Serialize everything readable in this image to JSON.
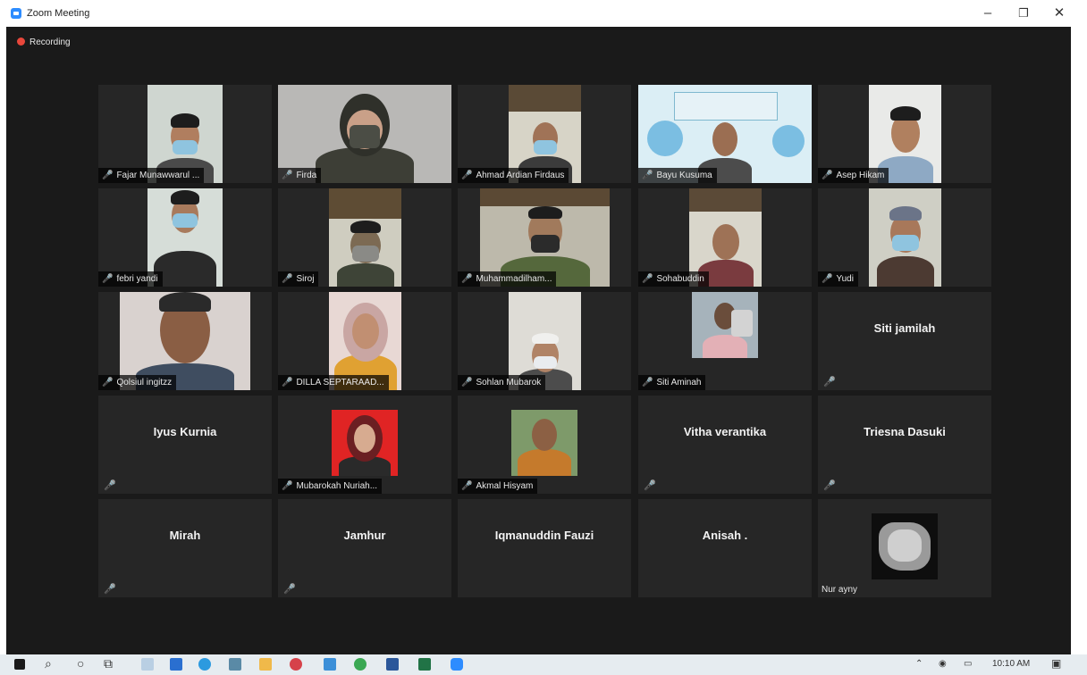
{
  "window": {
    "title": "Zoom Meeting",
    "minimize": "–",
    "restore": "❐",
    "close": "✕"
  },
  "recording": {
    "label": "Recording"
  },
  "participants": [
    {
      "name": "Fajar Munawwarul ..."
    },
    {
      "name": "Firda"
    },
    {
      "name": "Ahmad Ardian Firdaus"
    },
    {
      "name": "Bayu Kusuma"
    },
    {
      "name": "Asep Hikam"
    },
    {
      "name": "febri yandi"
    },
    {
      "name": "Siroj"
    },
    {
      "name": "Muhammadilham..."
    },
    {
      "name": "Sohabuddin"
    },
    {
      "name": "Yudi"
    },
    {
      "name": "Qolsiul ingitzz"
    },
    {
      "name": "DILLA SEPTARAAD..."
    },
    {
      "name": "Sohlan Mubarok"
    },
    {
      "name": "Siti Aminah"
    },
    {
      "name": "Siti jamilah"
    },
    {
      "name": "Iyus Kurnia"
    },
    {
      "name": "Mubarokah Nuriah..."
    },
    {
      "name": "Akmal Hisyam"
    },
    {
      "name": "Vitha verantika"
    },
    {
      "name": "Triesna Dasuki"
    },
    {
      "name": "Mirah"
    },
    {
      "name": "Jamhur"
    },
    {
      "name": "Iqmanuddin Fauzi"
    },
    {
      "name": "Anisah ."
    },
    {
      "name": "Nur ayny"
    }
  ],
  "taskbar": {
    "time": "10:10 AM"
  },
  "colors": {
    "meeting_bg": "#1a1a1a",
    "tile_bg": "#262626",
    "muted_red": "#e8473b",
    "taskbar_bg": "#e6ecf0"
  }
}
